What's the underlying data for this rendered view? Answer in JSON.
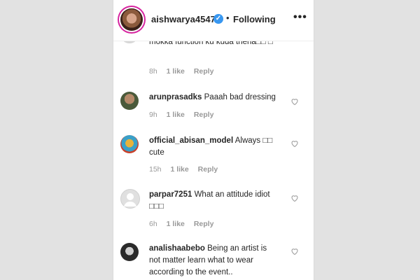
{
  "header": {
    "username": "aishwarya4547",
    "separator": "•",
    "following": "Following",
    "more": "•••",
    "verified": "✓"
  },
  "comments": [
    {
      "username": "",
      "text": "mokka function ku kuda thena□□ □",
      "time": "8h",
      "likes": "1 like",
      "reply": "Reply"
    },
    {
      "username": "arunprasadks",
      "text": "Paaah bad dressing",
      "time": "9h",
      "likes": "1 like",
      "reply": "Reply"
    },
    {
      "username": "official_abisan_model",
      "text": "Always □□ cute",
      "time": "15h",
      "likes": "1 like",
      "reply": "Reply"
    },
    {
      "username": "parpar7251",
      "text": "What an attitude idiot □□□",
      "time": "6h",
      "likes": "1 like",
      "reply": "Reply"
    },
    {
      "username": "analishaabebo",
      "text": "Being an artist is not matter learn what to wear according to the event..",
      "time": "",
      "likes": "",
      "reply": ""
    }
  ],
  "colors": {
    "background": "#e2e2e2",
    "panel": "#ffffff",
    "meta": "#999999",
    "verified": "#3897f0"
  },
  "icons": [
    "verified-badge-icon",
    "more-options-icon",
    "heart-icon"
  ]
}
